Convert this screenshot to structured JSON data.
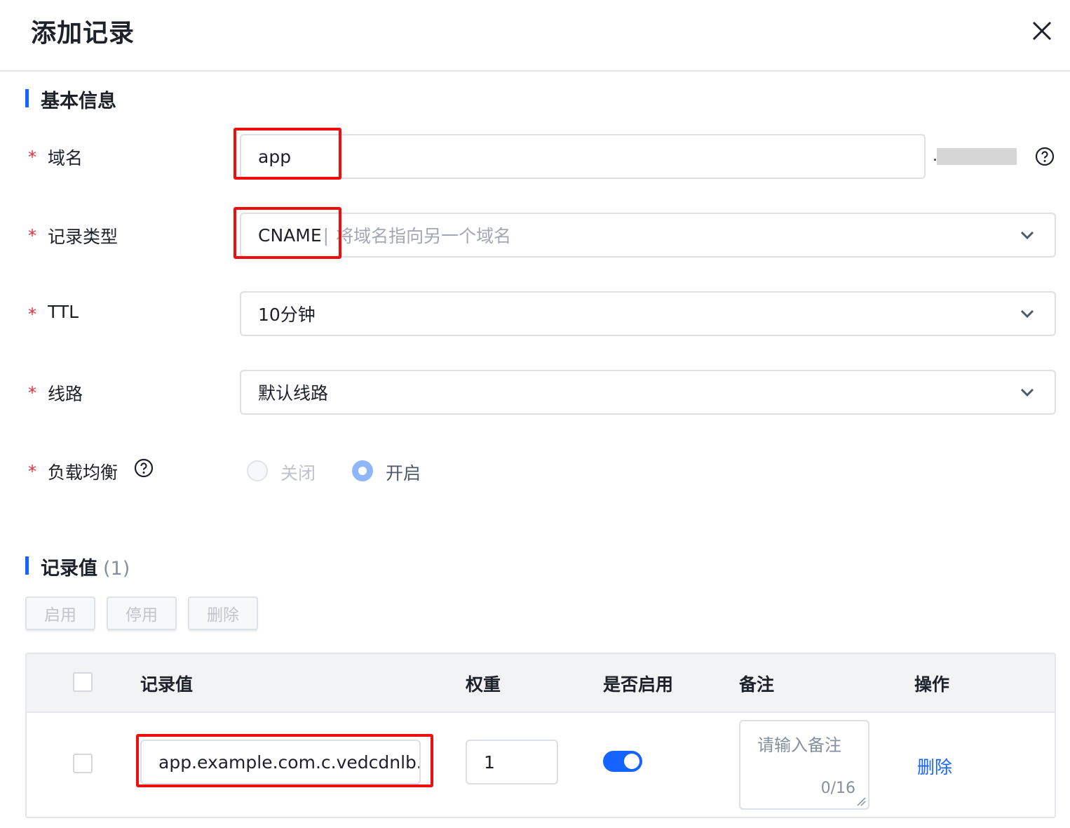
{
  "dialog": {
    "title": "添加记录"
  },
  "basic_info": {
    "heading": "基本信息",
    "domain": {
      "label": "域名",
      "value": "app",
      "suffix_dot": "."
    },
    "record_type": {
      "label": "记录类型",
      "value": "CNAME",
      "caret": "|",
      "hint": "将域名指向另一个域名"
    },
    "ttl": {
      "label": "TTL",
      "value": "10分钟"
    },
    "line": {
      "label": "线路",
      "value": "默认线路"
    },
    "load_balance": {
      "label": "负载均衡",
      "options": [
        {
          "label": "关闭",
          "selected": false,
          "disabled": true
        },
        {
          "label": "开启",
          "selected": true,
          "disabled": true
        }
      ]
    },
    "required_mark": "*"
  },
  "records": {
    "heading": "记录值",
    "count": "(1)",
    "toolbar": {
      "enable": "启用",
      "disable": "停用",
      "delete": "删除"
    },
    "columns": [
      "记录值",
      "权重",
      "是否启用",
      "备注",
      "操作"
    ],
    "rows": [
      {
        "value": "app.example.com.c.vedcdnlb.c",
        "weight": "1",
        "enabled": true,
        "remark_placeholder": "请输入备注",
        "remark_counter": "0/16",
        "action": "删除"
      }
    ]
  },
  "colors": {
    "accent": "#1664ff",
    "required": "#e5303f",
    "highlight_box": "#f00d0d"
  },
  "icons": {
    "close": "close-icon",
    "help": "question-circle-icon",
    "dropdown": "chevron-down-icon"
  }
}
